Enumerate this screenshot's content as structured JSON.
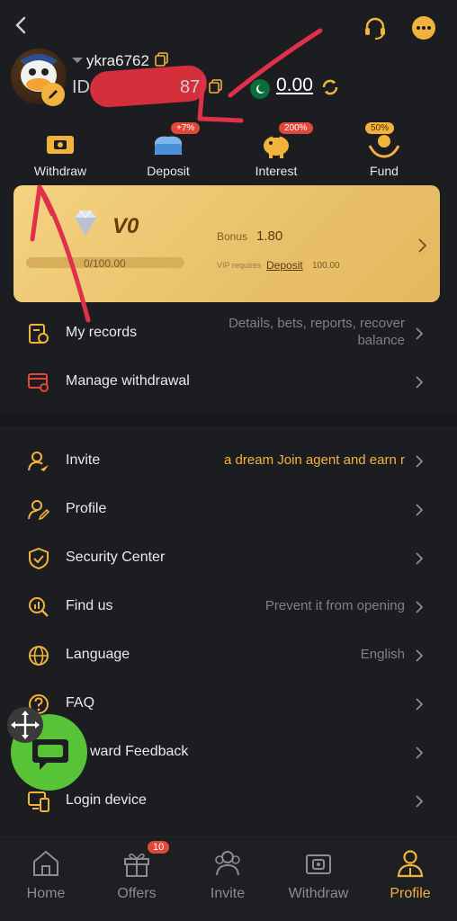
{
  "header": {
    "back_icon": "chevron-left-icon",
    "support_icon": "headset-icon",
    "chat_icon": "chat-dots-icon"
  },
  "profile": {
    "username": "ykra6762",
    "id_label": "ID:",
    "id_fragment": "87",
    "balance": "0.00"
  },
  "quick_actions": [
    {
      "label": "Withdraw",
      "badge": ""
    },
    {
      "label": "Deposit",
      "badge": "+7%"
    },
    {
      "label": "Interest",
      "badge": "200%"
    },
    {
      "label": "Fund",
      "badge": "50%"
    }
  ],
  "vip": {
    "level": "V0",
    "progress_text": "0/100.00",
    "progress_fraction": 0,
    "bonus_label": "Bonus",
    "bonus_value": "1.80",
    "requires_label": "VIP requires",
    "deposit_link": "Deposit",
    "deposit_amount": "100.00"
  },
  "menu_top": [
    {
      "label": "My records",
      "value": "Details, bets, reports, recover balance"
    },
    {
      "label": "Manage withdrawal",
      "value": ""
    }
  ],
  "menu_main": [
    {
      "label": "Invite",
      "value": "a dream  Join agent and earn r"
    },
    {
      "label": "Profile",
      "value": ""
    },
    {
      "label": "Security Center",
      "value": ""
    },
    {
      "label": "Find us",
      "value": "Prevent it from opening"
    },
    {
      "label": "Language",
      "value": "English"
    },
    {
      "label": "FAQ",
      "value": ""
    },
    {
      "label": "Reward Feedback",
      "label_visible": "ward Feedback",
      "value": ""
    },
    {
      "label": "Login device",
      "value": ""
    }
  ],
  "tabbar": [
    {
      "label": "Home",
      "badge": ""
    },
    {
      "label": "Offers",
      "badge": "10"
    },
    {
      "label": "Invite",
      "badge": ""
    },
    {
      "label": "Withdraw",
      "badge": ""
    },
    {
      "label": "Profile",
      "badge": ""
    }
  ],
  "colors": {
    "accent": "#f2b33d",
    "background": "#1c1d21",
    "badge_red": "#e2483a",
    "chat_green": "#58c336",
    "vip_card": "#f0cc78"
  }
}
